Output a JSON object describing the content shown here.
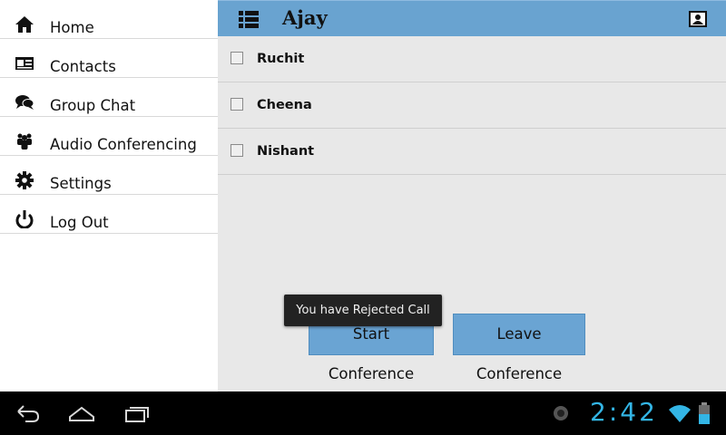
{
  "sidebar": {
    "items": [
      {
        "label": "Home",
        "icon": "home-icon"
      },
      {
        "label": "Contacts",
        "icon": "contacts-card-icon"
      },
      {
        "label": "Group Chat",
        "icon": "chat-bubbles-icon"
      },
      {
        "label": "Audio Conferencing",
        "icon": "people-group-icon"
      },
      {
        "label": "Settings",
        "icon": "gear-icon"
      },
      {
        "label": "Log Out",
        "icon": "power-icon"
      }
    ]
  },
  "header": {
    "title": "Ajay",
    "menu_icon": "list-menu-icon",
    "contact_icon": "contact-card-icon",
    "background": "#69a3d0"
  },
  "participants": [
    {
      "name": "Ruchit",
      "checked": false
    },
    {
      "name": "Cheena",
      "checked": false
    },
    {
      "name": "Nishant",
      "checked": false
    }
  ],
  "buttons": {
    "start": "Start Conference",
    "leave": "Leave Conference"
  },
  "toast": "You have Rejected Call",
  "system_bar": {
    "time": "2:42",
    "nav": [
      "back-icon",
      "home-nav-icon",
      "recent-apps-icon"
    ],
    "status_icons": [
      "notification-icon",
      "wifi-icon",
      "battery-icon"
    ],
    "accent": "#33b5e5"
  }
}
